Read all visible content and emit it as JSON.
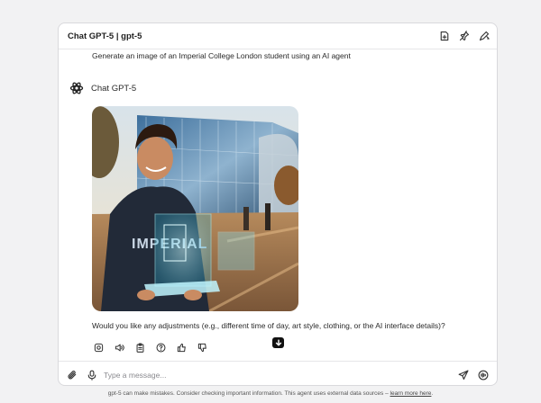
{
  "header": {
    "title": "Chat GPT-5 | gpt-5",
    "actions": [
      "new-chat-icon",
      "pin-icon",
      "edit-icon"
    ]
  },
  "conversation": {
    "user_message": "Generate an image of an Imperial College London student using an AI agent",
    "assistant_name": "Chat GPT-5",
    "image": {
      "subject": "smiling student holding a glowing tablet with holographic AI interface in front of a glass university building",
      "shirt_text": "IMPERIAL"
    },
    "followup": "Would you like any adjustments (e.g., different time of day, art style, clothing, or the AI interface details)?",
    "message_actions": [
      "copy-image-icon",
      "read-aloud-icon",
      "clipboard-icon",
      "help-icon",
      "thumbs-up-icon",
      "thumbs-down-icon"
    ]
  },
  "composer": {
    "placeholder": "Type a message..."
  },
  "disclaimer": {
    "text": "gpt-5 can make mistakes. Consider checking important information. This agent uses external data sources – ",
    "link": "learn more here",
    "suffix": "."
  },
  "colors": {
    "background": "#f2f2f3",
    "window": "#ffffff",
    "border": "#d9d9dc",
    "text": "#1f1f1f"
  }
}
